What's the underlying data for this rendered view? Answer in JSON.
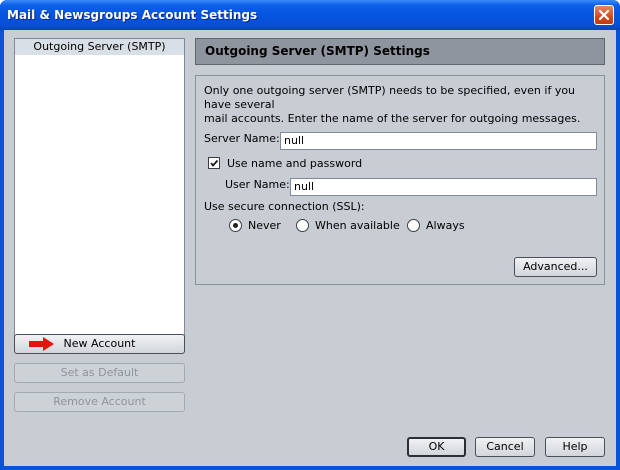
{
  "window": {
    "title": "Mail & Newsgroups Account Settings"
  },
  "sidebar": {
    "items": [
      "Outgoing Server (SMTP)"
    ],
    "new_account": "New Account",
    "set_default": "Set as Default",
    "remove_account": "Remove Account"
  },
  "panel": {
    "header": "Outgoing Server (SMTP) Settings",
    "description_line1": "Only one outgoing server (SMTP) needs to be specified, even if you have several",
    "description_line2": "mail accounts. Enter the name of the server for outgoing messages.",
    "server_name_label": "Server Name:",
    "server_name_value": "null",
    "use_name_password_label": "Use name and password",
    "use_name_password_checked": true,
    "user_name_label": "User Name:",
    "user_name_value": "null",
    "ssl_label": "Use secure connection (SSL):",
    "ssl_options": [
      "Never",
      "When available",
      "Always"
    ],
    "ssl_selected": "Never",
    "advanced": "Advanced..."
  },
  "footer": {
    "ok": "OK",
    "cancel": "Cancel",
    "help": "Help"
  },
  "colors": {
    "titlebar": "#0554e0",
    "dialog_bg": "#c8cdd3",
    "header_bg": "#8e959e",
    "arrow": "#e8120c"
  }
}
